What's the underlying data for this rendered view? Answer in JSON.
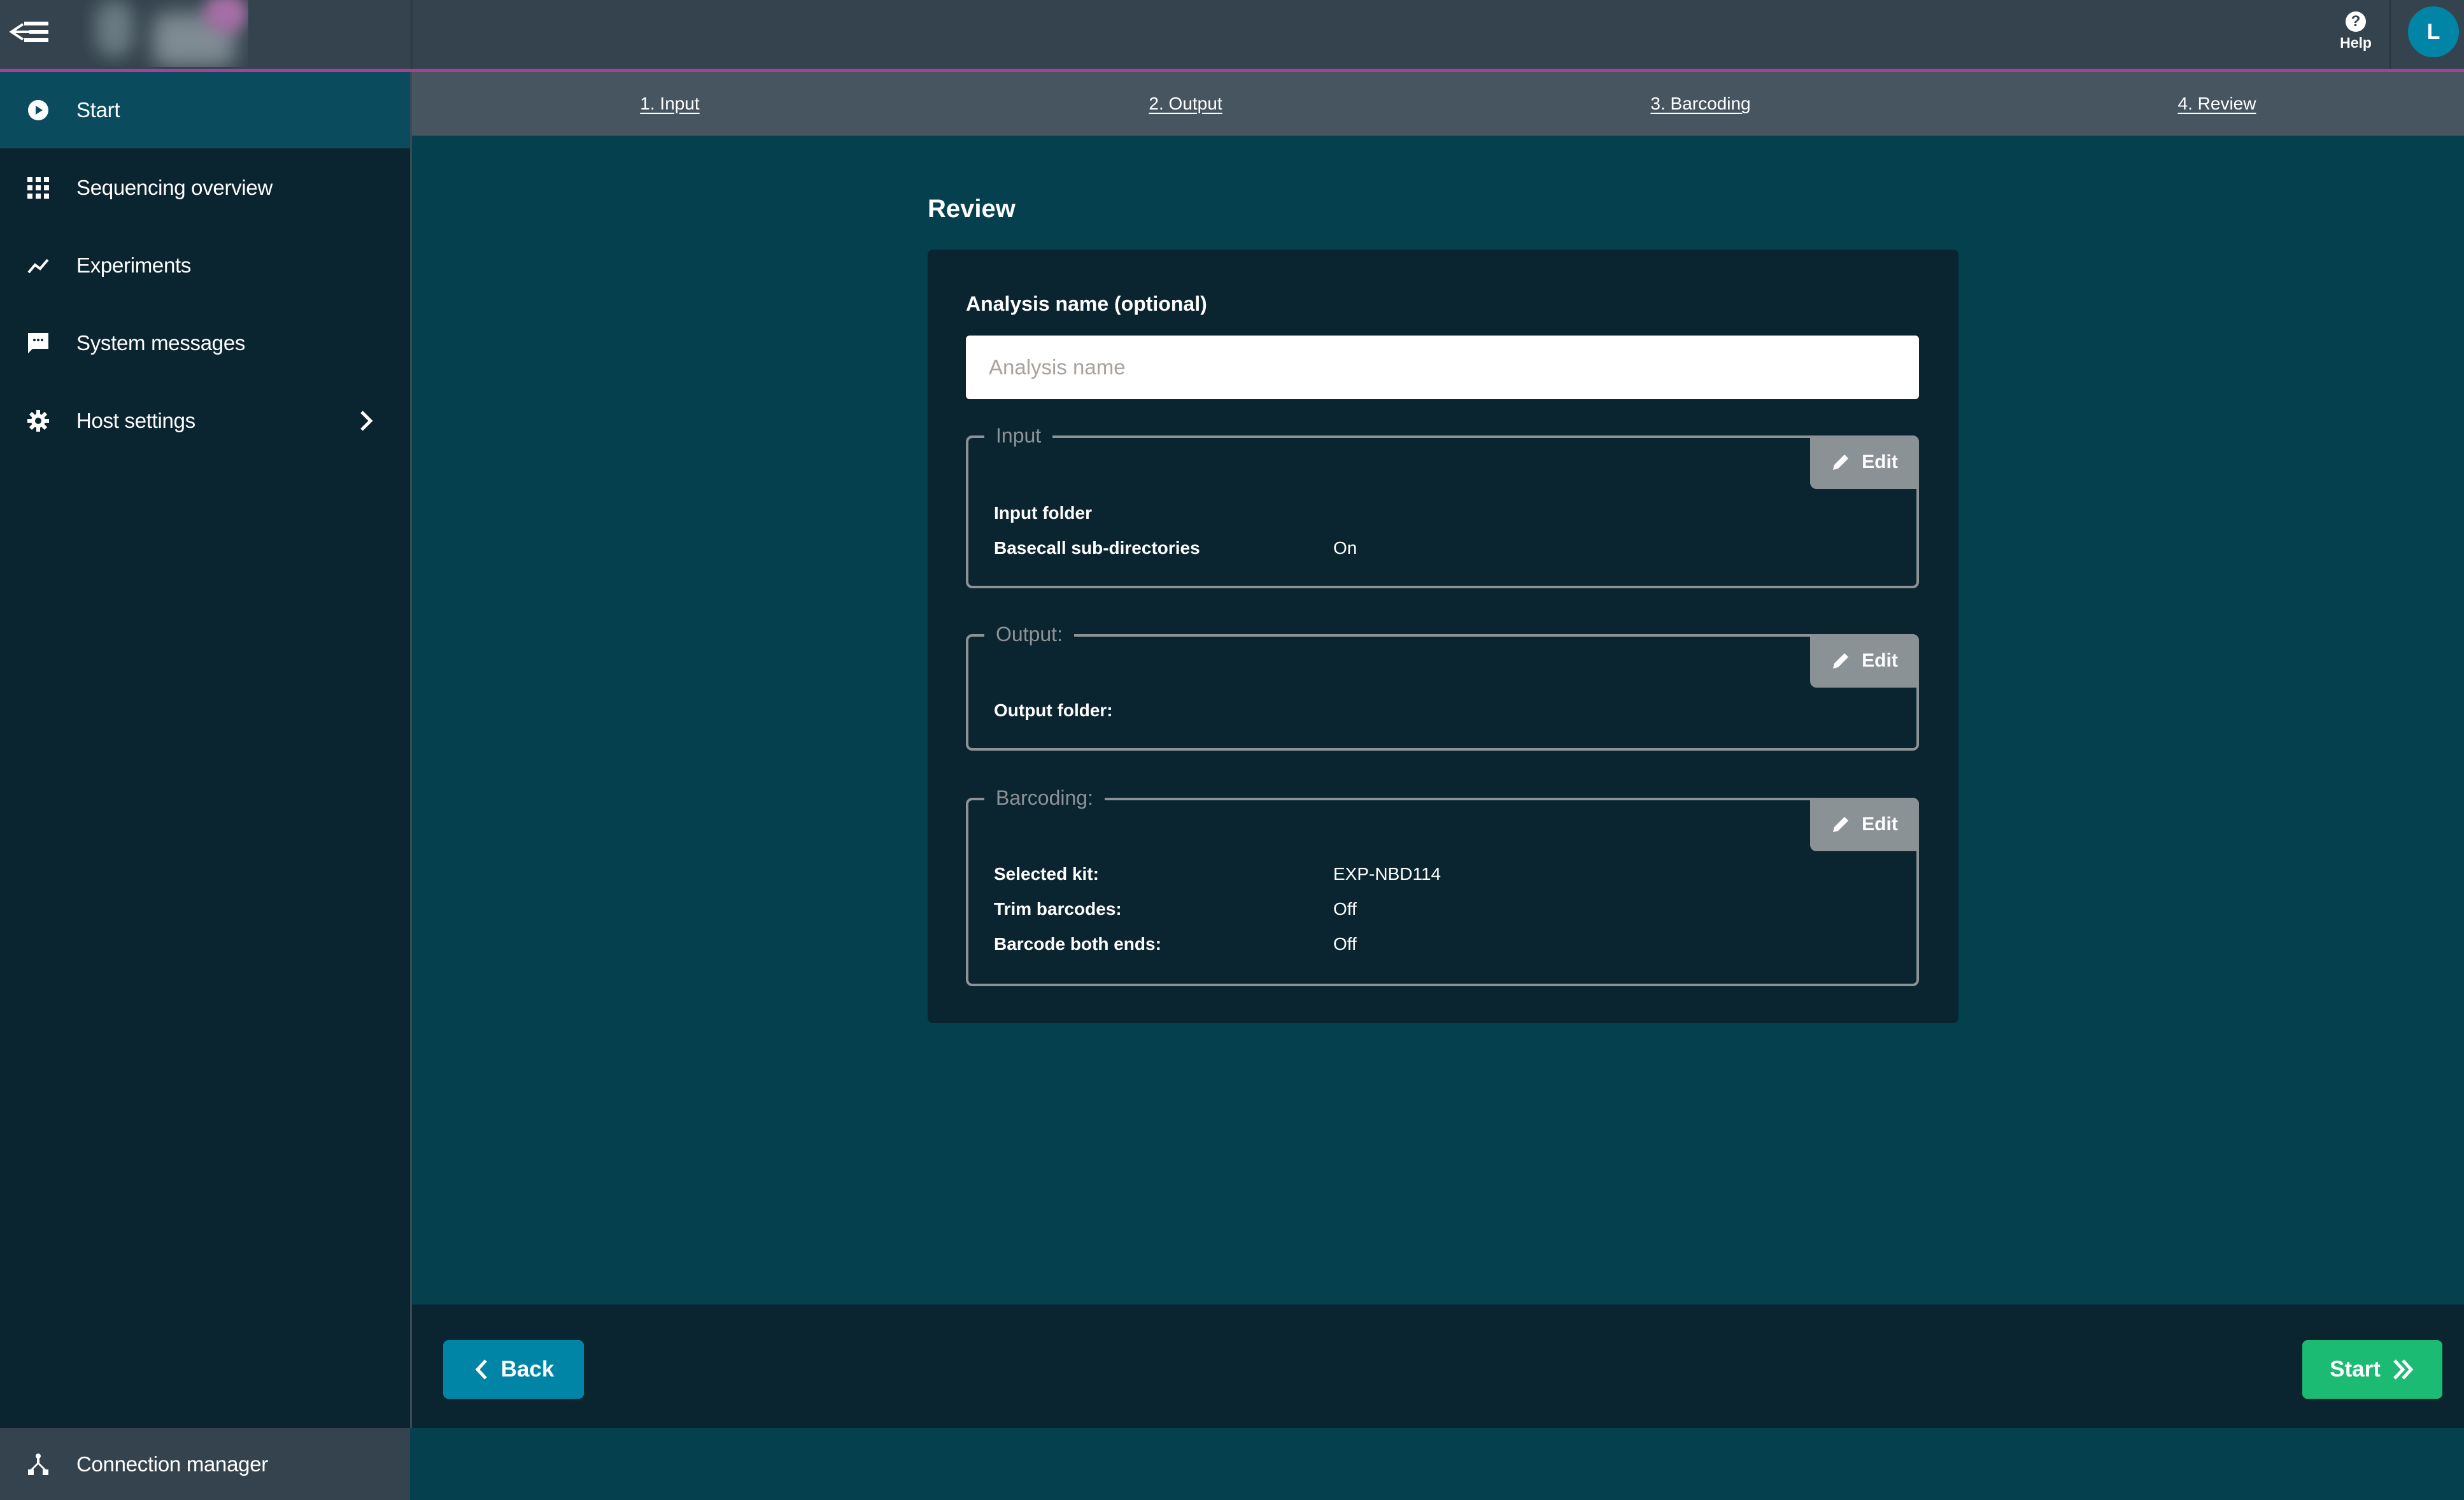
{
  "topbar": {
    "menu_icon": "collapse-menu-icon",
    "help_label": "Help",
    "help_icon": "question-circle-icon",
    "avatar_initial": "L"
  },
  "sidebar": {
    "items": [
      {
        "label": "Start",
        "icon": "play-circle-icon",
        "active": true
      },
      {
        "label": "Sequencing overview",
        "icon": "grid-icon",
        "active": false
      },
      {
        "label": "Experiments",
        "icon": "trend-line-icon",
        "active": false
      },
      {
        "label": "System messages",
        "icon": "message-icon",
        "active": false
      },
      {
        "label": "Host settings",
        "icon": "gear-icon",
        "active": false,
        "has_submenu": true
      }
    ],
    "bottom_item": {
      "label": "Connection manager",
      "icon": "network-icon"
    }
  },
  "steps": [
    {
      "label": "1. Input"
    },
    {
      "label": "2. Output"
    },
    {
      "label": "3. Barcoding"
    },
    {
      "label": "4. Review"
    }
  ],
  "page": {
    "title": "Review",
    "analysis_name": {
      "label": "Analysis name (optional)",
      "placeholder": "Analysis name",
      "value": ""
    },
    "sections": {
      "input": {
        "legend": "Input",
        "edit_label": "Edit",
        "rows": [
          {
            "label": "Input folder",
            "value": ""
          },
          {
            "label": "Basecall sub-directories",
            "value": "On"
          }
        ]
      },
      "output": {
        "legend": "Output:",
        "edit_label": "Edit",
        "rows": [
          {
            "label": "Output folder:",
            "value": ""
          }
        ]
      },
      "barcoding": {
        "legend": "Barcoding:",
        "edit_label": "Edit",
        "rows": [
          {
            "label": "Selected kit:",
            "value": "EXP-NBD114"
          },
          {
            "label": "Trim barcodes:",
            "value": "Off"
          },
          {
            "label": "Barcode both ends:",
            "value": "Off"
          }
        ]
      }
    }
  },
  "footer": {
    "back_label": "Back",
    "start_label": "Start"
  },
  "colors": {
    "accent_magenta": "#a8409a",
    "primary_blue": "#0085a6",
    "start_green": "#1bbb73",
    "sidebar_bg": "#0a252f",
    "main_bg": "#05404f"
  }
}
